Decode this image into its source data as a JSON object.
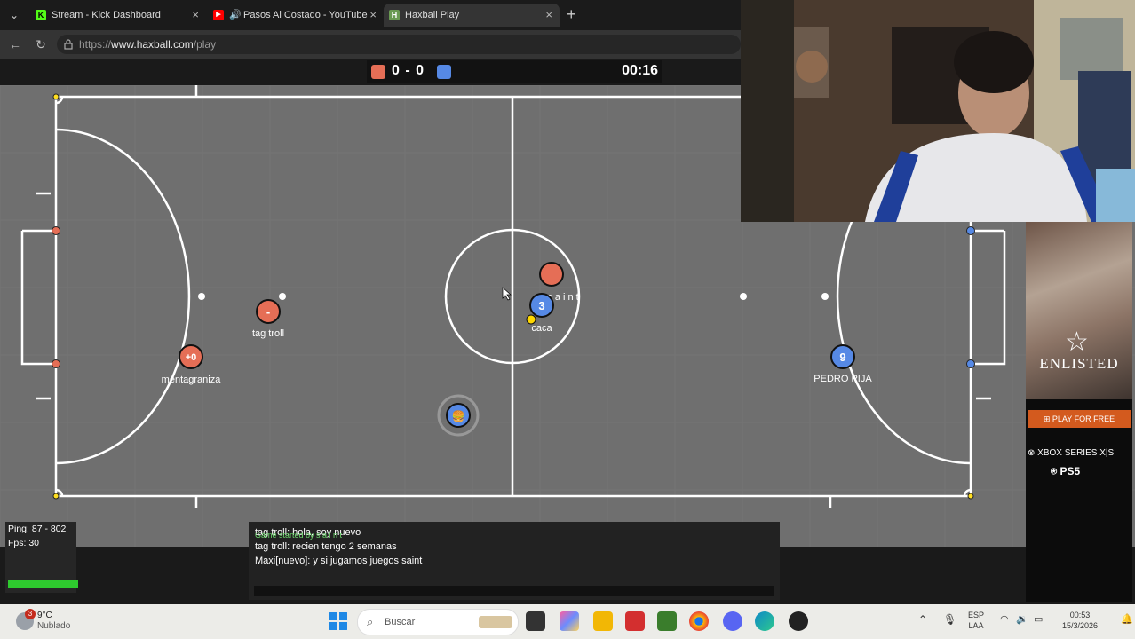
{
  "browser": {
    "tabs": [
      {
        "title": "Stream - Kick Dashboard",
        "close": "×"
      },
      {
        "title": "Pasos Al Costado - YouTube",
        "close": "×"
      },
      {
        "title": "Haxball Play",
        "close": "×"
      }
    ],
    "new_tab": "+",
    "url_prefix": "https://",
    "url_host": "www.haxball.com",
    "url_path": "/play"
  },
  "scoreboard": {
    "score": "0 - 0",
    "time": "00:16",
    "red_color": "#e56e56",
    "blue_color": "#5689e5"
  },
  "players": [
    {
      "name": "mentagraniza",
      "avatar": "+0",
      "team": "red"
    },
    {
      "name": "tag troll",
      "avatar": "-",
      "team": "red"
    },
    {
      "name": "s a i n t",
      "avatar": "",
      "team": "red"
    },
    {
      "name": "caca",
      "avatar": "3",
      "team": "blue"
    },
    {
      "name": "PEDRO PIJA",
      "avatar": "9",
      "team": "blue"
    },
    {
      "name": "",
      "avatar": "🍔",
      "team": "blue"
    }
  ],
  "stats": {
    "ping": "Ping: 87 - 802",
    "fps": "Fps: 30"
  },
  "chat": [
    {
      "text": "tag troll: hola, soy nuevo",
      "system": false
    },
    {
      "text": "Game started by s a i n t",
      "system": true
    },
    {
      "text": "tag troll: recien tengo 2 semanas",
      "system": false
    },
    {
      "text": "Maxi[nuevo]: y si jugamos juegos saint",
      "system": false
    }
  ],
  "ad": {
    "title": "ENLISTED",
    "cta": "PLAY FOR FREE",
    "platform1": "XBOX SERIES X|S",
    "platform2": "PS5"
  },
  "taskbar": {
    "weather_temp": "9°C",
    "weather_cond": "Nublado",
    "weather_badge": "3",
    "search_placeholder": "Buscar",
    "lang1": "ESP",
    "lang2": "LAA",
    "time": "00:53",
    "date": "15/3/2026"
  }
}
